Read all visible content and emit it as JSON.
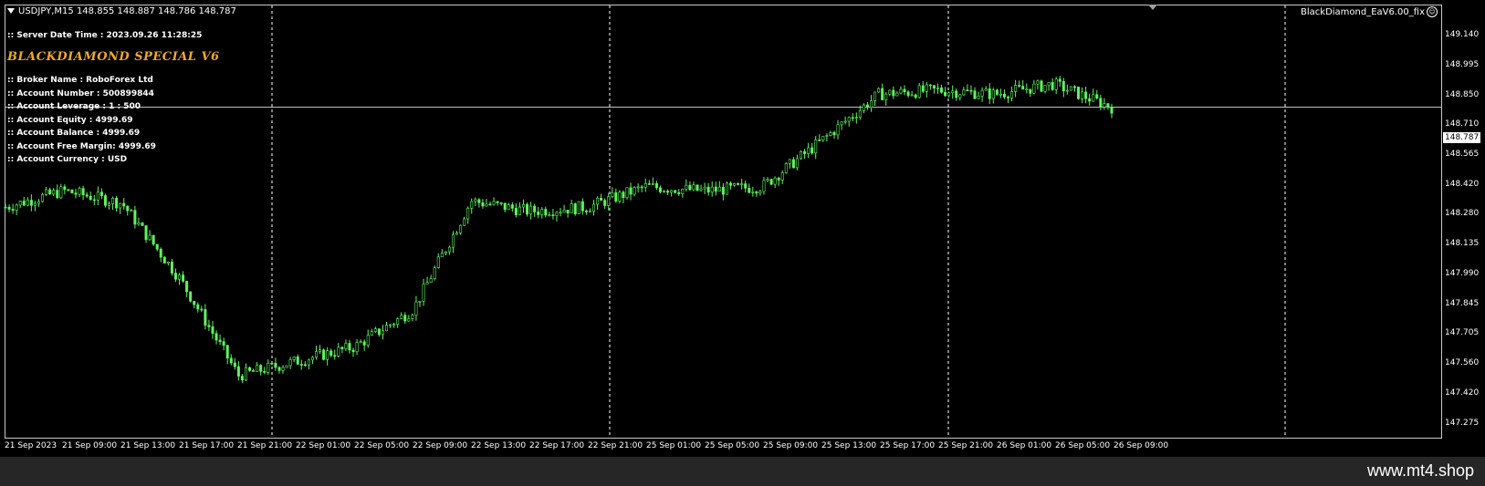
{
  "symbol_line": "USDJPY,M15  148.855 148.887 148.786 148.787",
  "ea_name": "BlackDiamond_EaV6.00_fix",
  "brand_title": "BLACKDIAMOND SPECIAL V6",
  "info_lines": [
    ":: Server Date Time : 2023.09.26 11:28:25",
    ":: Broker Name : RoboForex Ltd",
    ":: Account Number : 500899844",
    ":: Account Leverage : 1 : 500",
    ":: Account Equity : 4999.69",
    ":: Account Balance : 4999.69",
    ":: Account Free Margin: 4999.69",
    ":: Account Currency : USD"
  ],
  "current_price": "148.787",
  "price_labels": [
    "149.140",
    "148.995",
    "148.850",
    "148.710",
    "148.565",
    "148.420",
    "148.280",
    "148.135",
    "147.990",
    "147.845",
    "147.705",
    "147.560",
    "147.420",
    "147.275"
  ],
  "time_labels": [
    "21 Sep 2023",
    "21 Sep 09:00",
    "21 Sep 13:00",
    "21 Sep 17:00",
    "21 Sep 21:00",
    "22 Sep 01:00",
    "22 Sep 05:00",
    "22 Sep 09:00",
    "22 Sep 13:00",
    "22 Sep 17:00",
    "22 Sep 21:00",
    "25 Sep 01:00",
    "25 Sep 05:00",
    "25 Sep 09:00",
    "25 Sep 13:00",
    "25 Sep 17:00",
    "25 Sep 21:00",
    "26 Sep 01:00",
    "26 Sep 05:00",
    "26 Sep 09:00"
  ],
  "watermark": "www.mt4.shop",
  "colors": {
    "background": "#000000",
    "candle": "#5ef55e",
    "grid": "#ffffff",
    "text": "#ffffff",
    "title": "#f0a72d"
  },
  "chart_data": {
    "type": "line",
    "title": "USDJPY,M15",
    "y_range": [
      147.275,
      149.14
    ],
    "series": [
      {
        "x": [
          "21 Sep 2023",
          "21 Sep 09:00",
          "21 Sep 13:00",
          "21 Sep 17:00",
          "21 Sep 21:00",
          "22 Sep 01:00",
          "22 Sep 05:00",
          "22 Sep 09:00",
          "22 Sep 13:00",
          "22 Sep 17:00",
          "22 Sep 21:00",
          "25 Sep 01:00",
          "25 Sep 05:00",
          "25 Sep 09:00",
          "25 Sep 13:00",
          "25 Sep 17:00",
          "25 Sep 21:00",
          "26 Sep 01:00",
          "26 Sep 05:00",
          "26 Sep 09:00"
        ],
        "values": [
          148.3,
          148.38,
          148.32,
          147.95,
          147.48,
          147.55,
          147.62,
          147.8,
          148.33,
          148.28,
          148.3,
          148.4,
          148.38,
          148.4,
          148.62,
          148.85,
          148.87,
          148.85,
          148.9,
          148.787
        ]
      }
    ]
  }
}
